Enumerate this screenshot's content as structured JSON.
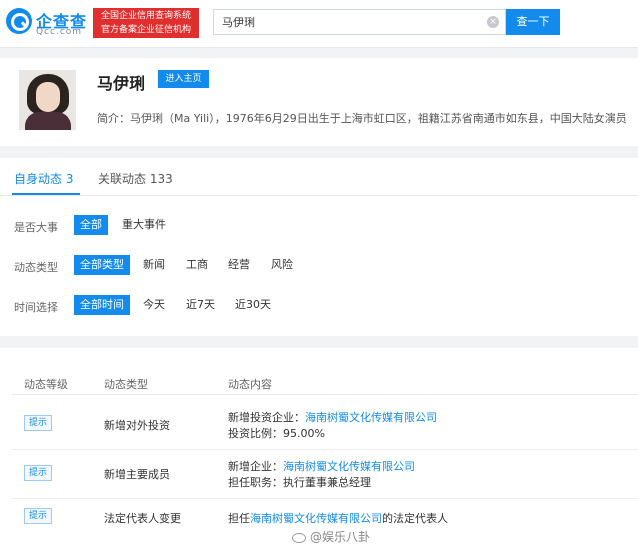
{
  "header": {
    "logo_name": "企查查",
    "logo_sub": "Qcc.com",
    "official_line1": "全国企业信用查询系统",
    "official_line2": "官方备案企业征信机构",
    "search_value": "马伊琍",
    "search_button": "查一下",
    "clear_icon": "×"
  },
  "profile": {
    "name": "马伊琍",
    "home_button": "进入主页",
    "intro": "简介：马伊琍（Ma Yili），1976年6月29日出生于上海市虹口区，祖籍江苏省南通市如东县，中国大陆女演员"
  },
  "tabs": [
    {
      "label": "自身动态 3",
      "active": true
    },
    {
      "label": "关联动态 133",
      "active": false
    }
  ],
  "filters": {
    "major": {
      "label": "是否大事",
      "options": [
        "全部",
        "重大事件"
      ],
      "selected": 0
    },
    "type": {
      "label": "动态类型",
      "options": [
        "全部类型",
        "新闻",
        "工商",
        "经营",
        "风险"
      ],
      "selected": 0
    },
    "time": {
      "label": "时间选择",
      "options": [
        "全部时间",
        "今天",
        "近7天",
        "近30天"
      ],
      "selected": 0
    }
  },
  "table": {
    "headers": [
      "动态等级",
      "动态类型",
      "动态内容"
    ],
    "rows": [
      {
        "level": "提示",
        "type": "新增对外投资",
        "line1_prefix": "新增投资企业：",
        "line1_link": "海南树蜀文化传媒有限公司",
        "line1_suffix": "",
        "line2": "投资比例：95.00%"
      },
      {
        "level": "提示",
        "type": "新增主要成员",
        "line1_prefix": "新增企业：",
        "line1_link": "海南树蜀文化传媒有限公司",
        "line1_suffix": "",
        "line2": "担任职务：执行董事兼总经理"
      },
      {
        "level": "提示",
        "type": "法定代表人变更",
        "line1_prefix": "担任",
        "line1_link": "海南树蜀文化传媒有限公司",
        "line1_suffix": "的法定代表人",
        "line2": ""
      }
    ]
  },
  "watermark": "@娱乐八卦"
}
